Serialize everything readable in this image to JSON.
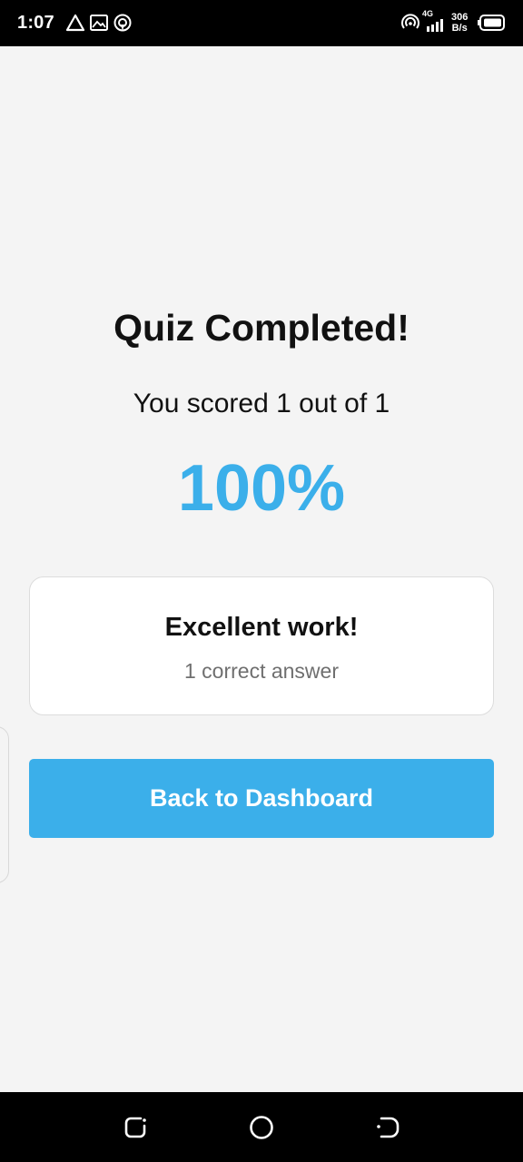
{
  "status_bar": {
    "time": "1:07",
    "network_label": "4G",
    "speed_value": "306",
    "speed_unit": "B/s",
    "left_icons": [
      "alert-triangle-icon",
      "image-icon",
      "hotspot-icon"
    ],
    "right_icons": [
      "hotspot-icon",
      "signal-icon",
      "battery-icon"
    ]
  },
  "quiz_result": {
    "title": "Quiz Completed!",
    "score_text": "You scored 1 out of 1",
    "percentage": "100%",
    "accent_color": "#3bafea"
  },
  "feedback_card": {
    "heading": "Excellent work!",
    "subtext": "1 correct answer"
  },
  "actions": {
    "back_button_label": "Back to Dashboard"
  },
  "nav_bar": {
    "buttons": [
      "recent-apps-icon",
      "home-icon",
      "back-icon"
    ]
  }
}
